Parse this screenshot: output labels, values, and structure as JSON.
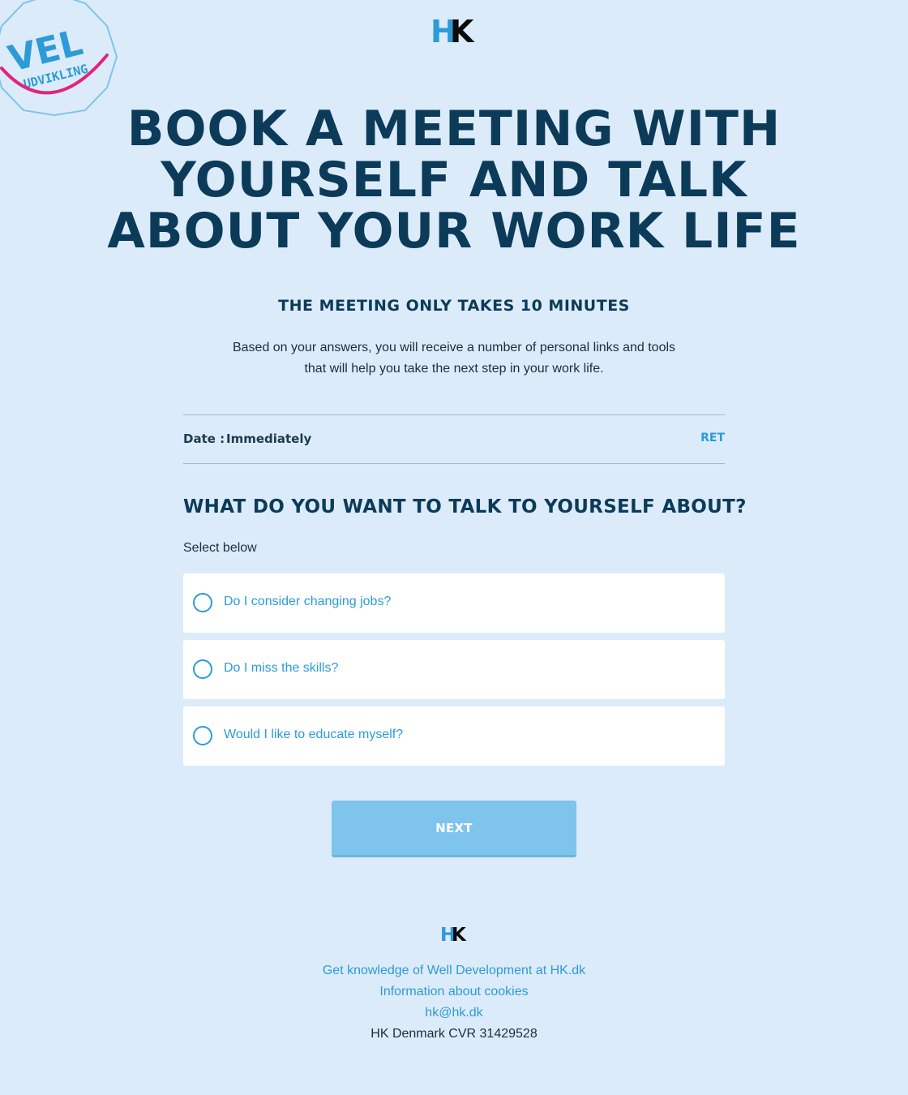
{
  "badge": {
    "title": "VEL",
    "subtitle": "UDVIKLING",
    "colors": {
      "text": "#2c9bd7",
      "smile": "#e0267b",
      "border": "#7ec4ec"
    }
  },
  "logo": {
    "letter_h": "H",
    "letter_k": "K",
    "colors": {
      "h": "#2c9bd7",
      "k": "#0b0b0b"
    }
  },
  "hero": {
    "headline_line1": "BOOK A MEETING WITH",
    "headline_line2": "YOURSELF AND TALK",
    "headline_line3": "ABOUT YOUR WORK LIFE",
    "subheadline": "THE MEETING ONLY TAKES 10 MINUTES",
    "intro_line1": "Based on your answers, you will receive a number of personal links and tools",
    "intro_line2": "that will help you take the next step in your work life."
  },
  "date": {
    "label": "Date :",
    "value": "Immediately",
    "edit_label": "RET"
  },
  "question": {
    "title": "WHAT DO YOU WANT TO TALK TO YOURSELF ABOUT?",
    "hint": "Select below",
    "options": [
      {
        "label": "Do I consider changing jobs?"
      },
      {
        "label": "Do I miss the skills?"
      },
      {
        "label": "Would I like to educate myself?"
      }
    ]
  },
  "actions": {
    "next_label": "NEXT"
  },
  "footer": {
    "link_knowledge": "Get knowledge of Well Development at HK.dk",
    "link_cookies": "Information about cookies",
    "link_email": "hk@hk.dk",
    "cvr": "HK Denmark CVR 31429528"
  },
  "colors": {
    "background": "#dcebfa",
    "heading": "#0b3b58",
    "accent": "#2c9bd7",
    "button": "#7ec4ec"
  }
}
